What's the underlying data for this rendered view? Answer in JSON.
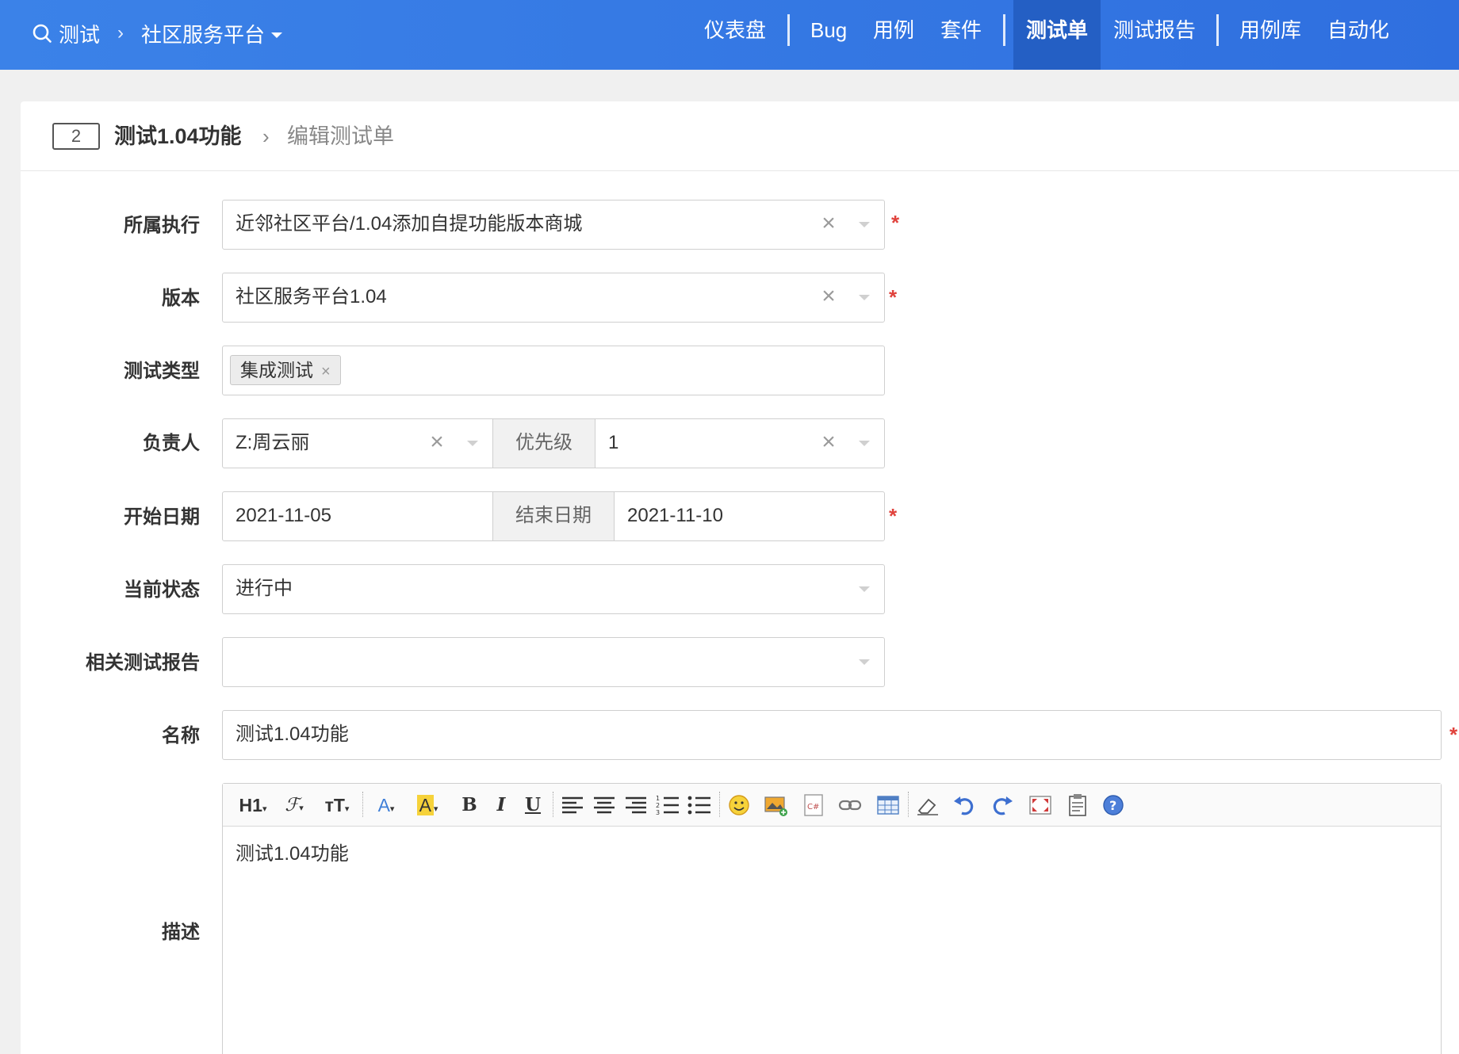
{
  "topbar": {
    "product": "测试",
    "breadcrumb_sep": "›",
    "project": "社区服务平台",
    "nav": [
      "仪表盘",
      "Bug",
      "用例",
      "套件",
      "测试单",
      "测试报告",
      "用例库",
      "自动化"
    ],
    "active_nav": "测试单"
  },
  "header": {
    "id": "2",
    "title": "测试1.04功能",
    "arrow": "›",
    "subtitle": "编辑测试单"
  },
  "form": {
    "execution_label": "所属执行",
    "execution_value": "近邻社区平台/1.04添加自提功能版本商城",
    "version_label": "版本",
    "version_value": "社区服务平台1.04",
    "type_label": "测试类型",
    "type_tag": "集成测试",
    "owner_label": "负责人",
    "owner_value": "Z:周云丽",
    "priority_label": "优先级",
    "priority_value": "1",
    "start_label": "开始日期",
    "start_value": "2021-11-05",
    "end_label": "结束日期",
    "end_value": "2021-11-10",
    "status_label": "当前状态",
    "status_value": "进行中",
    "report_label": "相关测试报告",
    "report_value": "",
    "name_label": "名称",
    "name_value": "测试1.04功能",
    "desc_label": "描述",
    "desc_value": "测试1.04功能",
    "required_mark": "*",
    "clear_glyph": "×"
  },
  "editor_toolbar": {
    "h1": "H1",
    "font": "ℱ",
    "size": "тT",
    "font_color": "A",
    "bg_color": "A",
    "bold": "B",
    "italic": "I",
    "underline": "U"
  },
  "colors": {
    "topbar": "#3b82e8",
    "active_nav": "#245fc4",
    "required": "#e0423c"
  }
}
